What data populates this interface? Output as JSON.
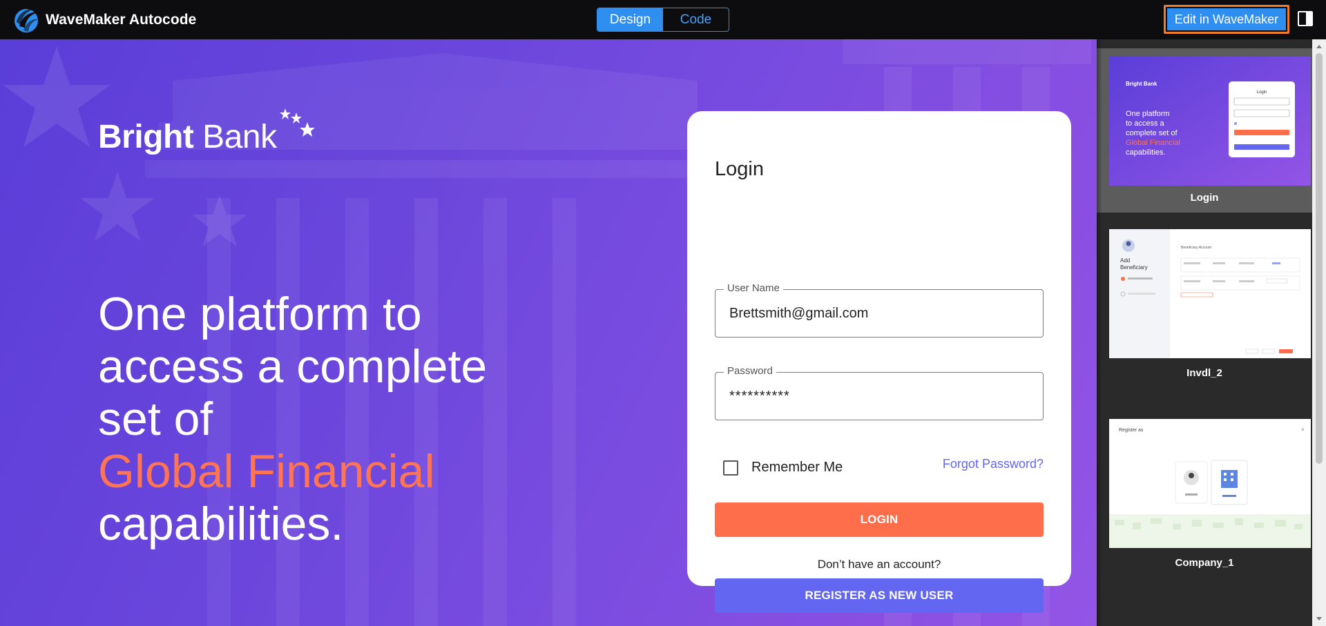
{
  "app": {
    "title": "WaveMaker Autocode",
    "tabs": [
      {
        "label": "Design",
        "active": true
      },
      {
        "label": "Code",
        "active": false
      }
    ],
    "edit_button": "Edit in WaveMaker",
    "accent_color": "#2f8ff0",
    "highlight_color": "#f07b2a"
  },
  "hero": {
    "bank_name_bold": "Bright",
    "bank_name_regular": "Bank",
    "headline_lines": [
      "One platform to",
      "access a complete",
      "set of"
    ],
    "headline_accent": "Global Financial",
    "headline_end": "capabilities.",
    "accent_color": "#ff7452"
  },
  "login": {
    "title": "Login",
    "username_label": "User Name",
    "username_value": "Brettsmith@gmail.com",
    "password_label": "Password",
    "password_value": "**********",
    "remember_label": "Remember Me",
    "remember_checked": false,
    "forgot_link": "Forgot Password?",
    "login_button": "LOGIN",
    "no_account_text": "Don’t have an account?",
    "register_button": "REGISTER AS NEW USER",
    "login_color": "#ff6e4a",
    "register_color": "#6266f1"
  },
  "thumbnails": {
    "items": [
      {
        "label": "Login",
        "selected": true,
        "preview": {
          "bank": "Bright Bank",
          "line1": "One platform",
          "line2": "to access a",
          "line3": "complete set of",
          "accent": "Global Financial",
          "line4": "capabilities.",
          "card_title": "Login"
        }
      },
      {
        "label": "Invdl_2",
        "selected": false,
        "preview": {
          "heading_1": "Add",
          "heading_2": "Beneficiary",
          "section_title": "Beneficiary Account"
        }
      },
      {
        "label": "Company_1",
        "selected": false,
        "preview": {
          "title": "Register as",
          "close": "×"
        }
      }
    ]
  }
}
